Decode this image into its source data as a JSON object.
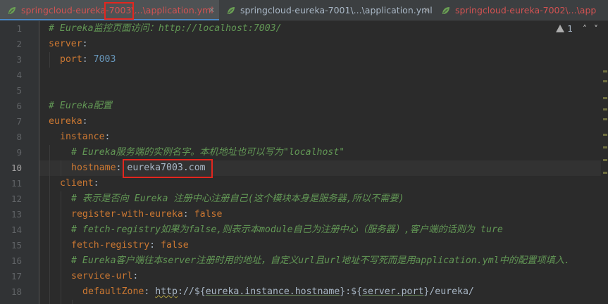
{
  "tabs": [
    {
      "label_pre": "springcloud-eureka-",
      "label_hl": "7003",
      "label_post": "\\...\\application.yml",
      "active": true,
      "color": "#d25252"
    },
    {
      "label_pre": "springcloud-eureka-7001\\...\\application.yml",
      "active": false,
      "color": "#a9b7c6"
    },
    {
      "label_pre": "springcloud-eureka-7002\\...\\app",
      "active": false,
      "color": "#d25252"
    }
  ],
  "inspections": {
    "warning_count": "1",
    "up": "˄",
    "down": "˅"
  },
  "current_line": 10,
  "line_numbers": [
    "1",
    "2",
    "3",
    "4",
    "5",
    "6",
    "7",
    "8",
    "9",
    "10",
    "11",
    "12",
    "13",
    "14",
    "15",
    "16",
    "17",
    "18"
  ],
  "code": {
    "l1_comment": "# Eureka监控页面访问：",
    "l1_url": "http://localhost:7003/",
    "l2_key": "server",
    "l3_key": "port",
    "l3_val": "7003",
    "l6_comment": "# Eureka配置",
    "l7_key": "eureka",
    "l8_key": "instance",
    "l9_comment": "# Eureka服务端的实例名字。本机地址也可以写为\"localhost\"",
    "l10_key": "hostname",
    "l10_val": "eureka7003.com",
    "l11_key": "client",
    "l12_comment": "# 表示是否向 Eureka 注册中心注册自己(这个模块本身是服务器,所以不需要)",
    "l13_key": "register-with-eureka",
    "l13_val": "false",
    "l14_comment": "# fetch-registry如果为false,则表示本module自己为注册中心（服务器）,客户端的话则为 ture",
    "l15_key": "fetch-registry",
    "l15_val": "false",
    "l16_comment": "# Eureka客户端往本server注册时用的地址，自定义url且url地址不写死而是用application.yml中的配置项填入.",
    "l17_key": "service-url",
    "l18_key": "defaultZone",
    "l18_v1": "http",
    "l18_v2": "://${",
    "l18_ph1": "eureka.instance.hostname",
    "l18_v3": "}:${",
    "l18_ph2": "server.port",
    "l18_v4": "}/eureka/"
  },
  "colors": {
    "comment": "#629755",
    "key": "#cc7832",
    "number": "#6897bb",
    "text": "#a9b7c6",
    "highlight_box": "#e3261e"
  }
}
